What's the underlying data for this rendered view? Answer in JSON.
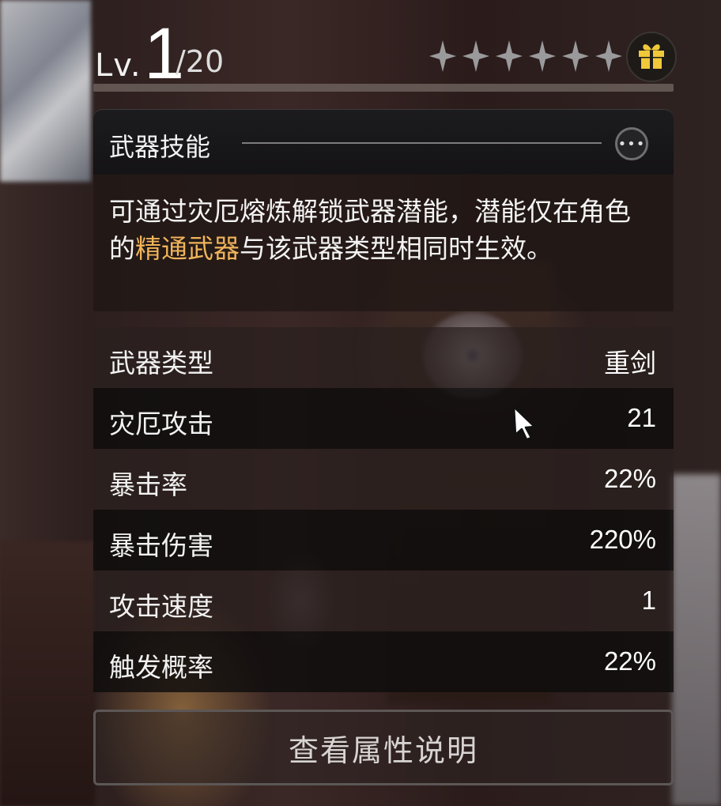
{
  "level": {
    "prefix": "Lv.",
    "value": "1",
    "max": "/20",
    "progress": 0.0
  },
  "stars": {
    "count": 6,
    "filled": 0,
    "color": "#9a9a9c"
  },
  "gift": {
    "icon": "gift-icon",
    "color": "#f0c93a"
  },
  "skill": {
    "title": "武器技能",
    "more_icon": "more-icon",
    "desc_part1": "可通过灾厄熔炼解锁武器潜能，潜能仅在角色的",
    "desc_highlight": "精通武器",
    "desc_part2": "与该武器类型相同时生效。",
    "highlight_color": "#f0b45a"
  },
  "stats": [
    {
      "label": "武器类型",
      "value": "重剑"
    },
    {
      "label": "灾厄攻击",
      "value": "21"
    },
    {
      "label": "暴击率",
      "value": "22%"
    },
    {
      "label": "暴击伤害",
      "value": "220%"
    },
    {
      "label": "攻击速度",
      "value": "1"
    },
    {
      "label": "触发概率",
      "value": "22%"
    }
  ],
  "button": {
    "label": "查看属性说明"
  }
}
